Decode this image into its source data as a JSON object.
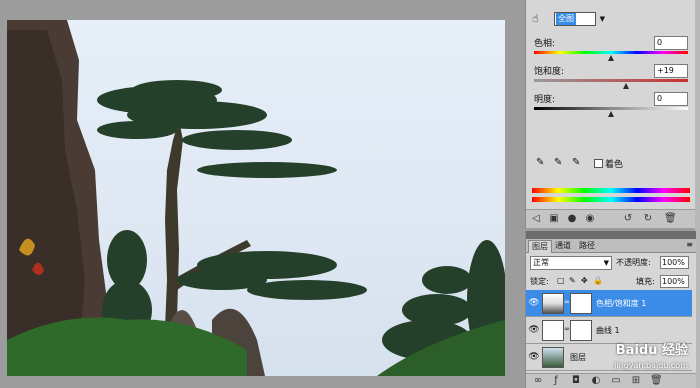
{
  "adjustments": {
    "channel_select": "全图",
    "hue": {
      "label": "色相:",
      "value": "0",
      "level": 0.5
    },
    "saturation": {
      "label": "饱和度:",
      "value": "+19",
      "level": 0.6
    },
    "lightness": {
      "label": "明度:",
      "value": "0",
      "level": 0.5
    },
    "colorize_label": "着色"
  },
  "layers": {
    "tabs": [
      "图层",
      "通道",
      "路径"
    ],
    "blend_mode": "正常",
    "opacity_label": "不透明度:",
    "opacity_value": "100%",
    "lock_label": "锁定:",
    "fill_label": "填充:",
    "fill_value": "100%",
    "items": [
      {
        "name": "色相/饱和度 1"
      },
      {
        "name": "曲线 1"
      },
      {
        "name": "图层"
      }
    ]
  },
  "watermark": {
    "text": "Baidu 经验",
    "url": "jingyan.baidu.com"
  },
  "colors": {
    "selection": "#3a8ce6"
  }
}
